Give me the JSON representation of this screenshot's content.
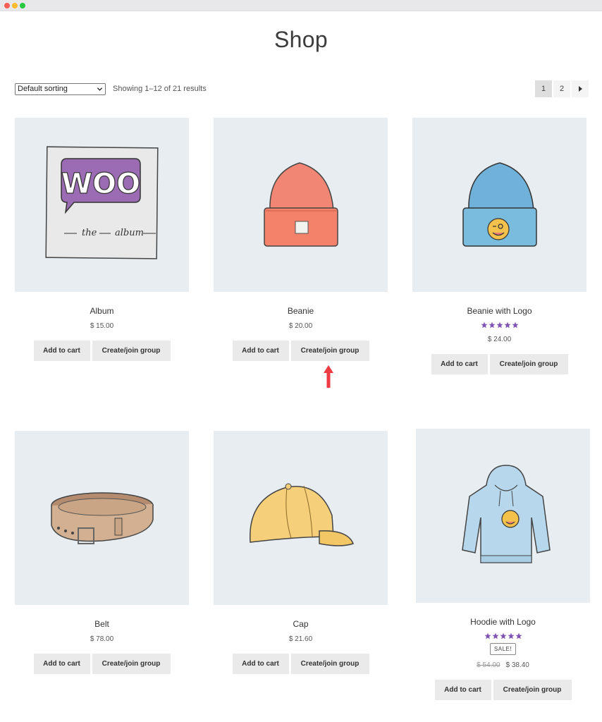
{
  "page": {
    "title": "Shop"
  },
  "toolbar": {
    "sort_value": "Default sorting",
    "result_count": "Showing 1–12 of 21 results"
  },
  "pagination": {
    "pages": [
      "1",
      "2"
    ],
    "current": "1",
    "next_icon": "chevron-right-icon"
  },
  "buttons": {
    "add_to_cart": "Add to cart",
    "create_join_group": "Create/join group"
  },
  "products": [
    {
      "name": "Album",
      "price": "$ 15.00",
      "image": "album-illustration"
    },
    {
      "name": "Beanie",
      "price": "$ 20.00",
      "image": "beanie-illustration"
    },
    {
      "name": "Beanie with Logo",
      "price": "$ 24.00",
      "rating": 5,
      "image": "beanie-logo-illustration"
    },
    {
      "name": "Belt",
      "price": "$ 78.00",
      "image": "belt-illustration"
    },
    {
      "name": "Cap",
      "price": "$ 21.60",
      "image": "cap-illustration"
    },
    {
      "name": "Hoodie with Logo",
      "price_old": "$ 54.00",
      "price": "$ 38.40",
      "rating": 5,
      "sale_badge": "SALE!",
      "image": "hoodie-illustration"
    }
  ],
  "annotation": {
    "icon": "red-arrow-up-icon",
    "color": "#ee3b43"
  },
  "colors": {
    "star": "#7f54b3",
    "thumb_bg": "#e7edf1",
    "button_bg": "#eaeaea"
  }
}
